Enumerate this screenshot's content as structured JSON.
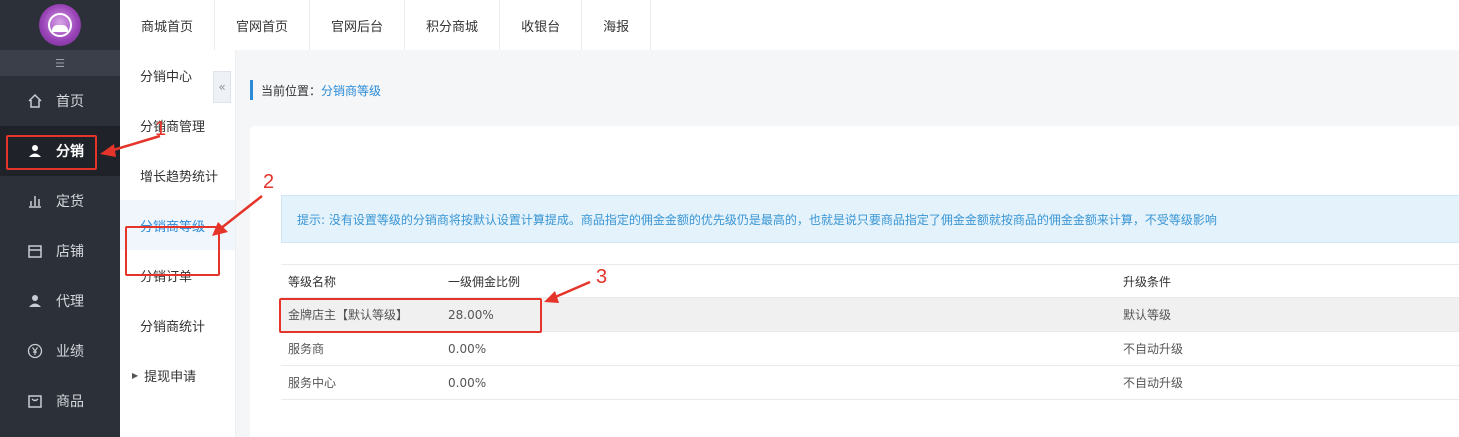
{
  "sidebar": {
    "collapse_icon": "collapse-menu-icon",
    "items": [
      {
        "label": "首页",
        "icon": "home-icon"
      },
      {
        "label": "分销",
        "icon": "user-icon"
      },
      {
        "label": "定货",
        "icon": "bar-chart-icon"
      },
      {
        "label": "店铺",
        "icon": "store-icon"
      },
      {
        "label": "代理",
        "icon": "user-icon"
      },
      {
        "label": "业绩",
        "icon": "yen-icon"
      },
      {
        "label": "商品",
        "icon": "bag-icon"
      }
    ]
  },
  "topbar": {
    "tabs": [
      "商城首页",
      "官网首页",
      "官网后台",
      "积分商城",
      "收银台",
      "海报"
    ]
  },
  "submenu": {
    "items": [
      "分销中心",
      "分销商管理",
      "增长趋势统计",
      "分销商等级",
      "分销订单",
      "分销商统计",
      "提现申请"
    ]
  },
  "breadcrumb": {
    "prefix": "当前位置：",
    "current": "分销商等级"
  },
  "tip": "提示: 没有设置等级的分销商将按默认设置计算提成。商品指定的佣金金额的优先级仍是最高的，也就是说只要商品指定了佣金金额就按商品的佣金金额来计算，不受等级影响",
  "table": {
    "headers": [
      "等级名称",
      "一级佣金比例",
      "升级条件"
    ],
    "rows": [
      {
        "name": "金牌店主【默认等级】",
        "ratio": "28.00%",
        "condition": "默认等级"
      },
      {
        "name": "服务商",
        "ratio": "0.00%",
        "condition": "不自动升级"
      },
      {
        "name": "服务中心",
        "ratio": "0.00%",
        "condition": "不自动升级"
      }
    ]
  },
  "annotations": [
    "1",
    "2",
    "3"
  ],
  "colors": {
    "accent": "#2a8bd8",
    "annotation": "#e5342a",
    "sidebar": "#2c3038"
  }
}
